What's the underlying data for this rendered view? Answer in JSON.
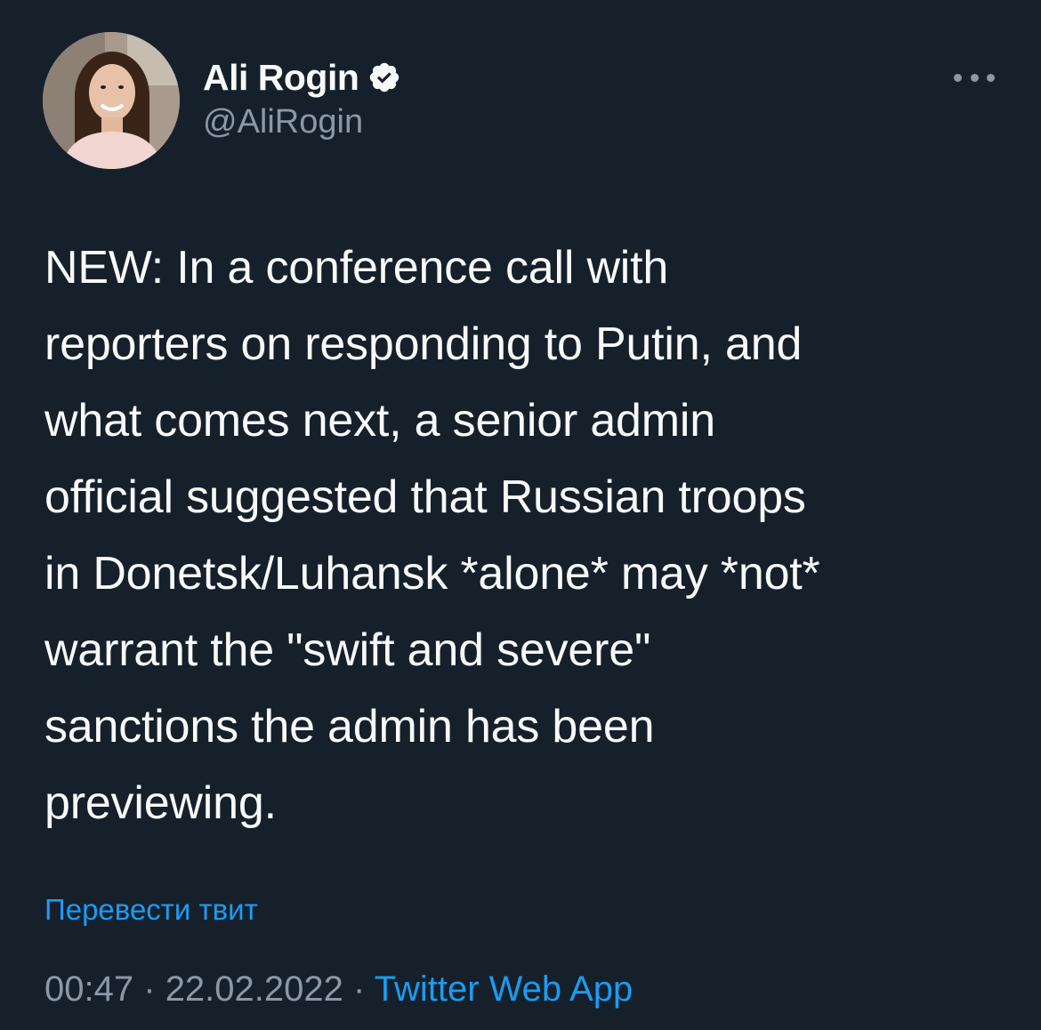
{
  "author": {
    "display_name": "Ali Rogin",
    "handle": "@AliRogin",
    "verified": true
  },
  "tweet": {
    "text": "NEW: In a conference call with\nreporters on responding to Putin, and\nwhat comes next, a senior admin\nofficial suggested that Russian troops\nin Donetsk/Luhansk *alone* may *not*\nwarrant the \"swift and severe\"\nsanctions the admin has been\npreviewing.",
    "translate_label": "Перевести твит",
    "time": "00:47",
    "separator": "·",
    "date": "22.02.2022",
    "source": "Twitter Web App"
  },
  "icons": {
    "verified": "verified-badge-icon",
    "more": "more-options-icon"
  },
  "colors": {
    "background": "#15202b",
    "primary_text": "#f7f9f9",
    "secondary_text": "#8b98a5",
    "accent": "#1d9bf0"
  }
}
